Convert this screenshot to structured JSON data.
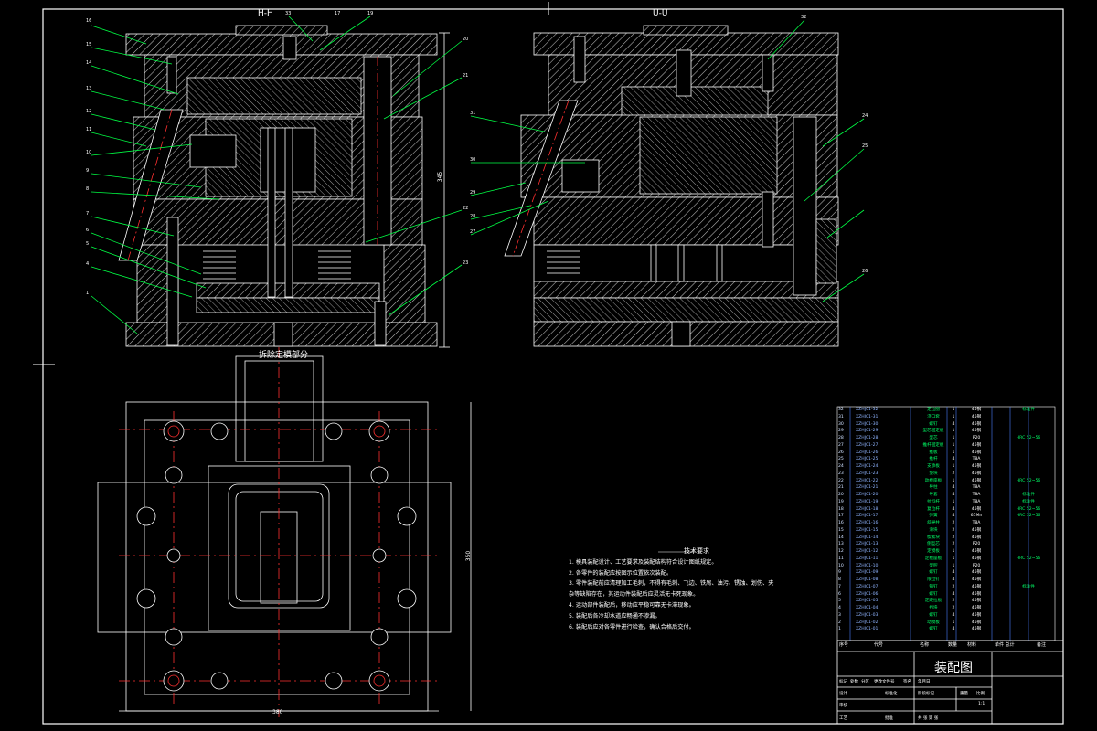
{
  "section_labels": {
    "left": "H-H",
    "right": "U-U"
  },
  "view_label": "拆除定模部分",
  "dimensions": {
    "overall_height": "345",
    "bottom_width": "380",
    "right_width": "350"
  },
  "left_callouts": [
    "16",
    "15",
    "14",
    "13",
    "12",
    "11",
    "10",
    "9",
    "8",
    "7",
    "6",
    "5",
    "4",
    "3",
    "2",
    "1"
  ],
  "top_callouts": [
    "33",
    "17",
    "18",
    "19"
  ],
  "right_callouts_left_view": [
    "20",
    "21",
    "22",
    "23"
  ],
  "right_view_callouts_left": [
    "31",
    "30",
    "29",
    "28",
    "27",
    "26"
  ],
  "right_view_callouts_right": [
    "32",
    "24",
    "25",
    "26"
  ],
  "technical_notes": {
    "title": "技术要求",
    "lines": [
      "1. 模具装配设计、工艺要求及装配结构符合设计图纸规定。",
      "2. 各零件的装配应按图示位置依次装配。",
      "3. 零件装配前应清理加工毛刺，不得有毛刺、飞边、铁屑、油污、锈蚀、划伤、夹",
      "   杂等缺陷存在，其运动件装配后应灵活无卡死现象。",
      "4. 运动部件装配后，移动应平稳可靠无卡滞现象。",
      "5. 装配后各冷却水道应畅通不渗漏。",
      "6. 装配后应对各零件进行检查，确认合格后交付。"
    ]
  },
  "bom": {
    "rows": [
      {
        "no": "32",
        "code": "XZHJ01-32",
        "name": "定位圈",
        "qty": "1",
        "material": "45钢",
        "note": "标准件"
      },
      {
        "no": "31",
        "code": "XZHJ01-31",
        "name": "浇口套",
        "qty": "1",
        "material": "45钢",
        "note": ""
      },
      {
        "no": "30",
        "code": "XZHJ01-30",
        "name": "螺钉",
        "qty": "4",
        "material": "45钢",
        "note": ""
      },
      {
        "no": "29",
        "code": "XZHJ01-29",
        "name": "型芯固定板",
        "qty": "1",
        "material": "45钢",
        "note": ""
      },
      {
        "no": "28",
        "code": "XZHJ01-28",
        "name": "型芯",
        "qty": "1",
        "material": "P20",
        "note": "HRC 52~56"
      },
      {
        "no": "27",
        "code": "XZHJ01-27",
        "name": "推杆固定板",
        "qty": "1",
        "material": "45钢",
        "note": ""
      },
      {
        "no": "26",
        "code": "XZHJ01-26",
        "name": "推板",
        "qty": "1",
        "material": "45钢",
        "note": ""
      },
      {
        "no": "25",
        "code": "XZHJ01-25",
        "name": "推杆",
        "qty": "4",
        "material": "T8A",
        "note": ""
      },
      {
        "no": "24",
        "code": "XZHJ01-24",
        "name": "支承板",
        "qty": "1",
        "material": "45钢",
        "note": ""
      },
      {
        "no": "23",
        "code": "XZHJ01-23",
        "name": "垫块",
        "qty": "2",
        "material": "45钢",
        "note": ""
      },
      {
        "no": "22",
        "code": "XZHJ01-22",
        "name": "动模座板",
        "qty": "1",
        "material": "45钢",
        "note": "HRC 52~56"
      },
      {
        "no": "21",
        "code": "XZHJ01-21",
        "name": "导柱",
        "qty": "4",
        "material": "T8A",
        "note": ""
      },
      {
        "no": "20",
        "code": "XZHJ01-20",
        "name": "导套",
        "qty": "4",
        "material": "T8A",
        "note": "标准件"
      },
      {
        "no": "19",
        "code": "XZHJ01-19",
        "name": "拉料杆",
        "qty": "1",
        "material": "T8A",
        "note": "标准件"
      },
      {
        "no": "18",
        "code": "XZHJ01-18",
        "name": "复位杆",
        "qty": "4",
        "material": "45钢",
        "note": "HRC 52~56"
      },
      {
        "no": "17",
        "code": "XZHJ01-17",
        "name": "弹簧",
        "qty": "4",
        "material": "65Mn",
        "note": "HRC 52~56"
      },
      {
        "no": "16",
        "code": "XZHJ01-16",
        "name": "斜导柱",
        "qty": "2",
        "material": "T8A",
        "note": ""
      },
      {
        "no": "15",
        "code": "XZHJ01-15",
        "name": "滑块",
        "qty": "2",
        "material": "45钢",
        "note": ""
      },
      {
        "no": "14",
        "code": "XZHJ01-14",
        "name": "楔紧块",
        "qty": "2",
        "material": "45钢",
        "note": ""
      },
      {
        "no": "13",
        "code": "XZHJ01-13",
        "name": "侧型芯",
        "qty": "2",
        "material": "P20",
        "note": ""
      },
      {
        "no": "12",
        "code": "XZHJ01-12",
        "name": "定模板",
        "qty": "1",
        "material": "45钢",
        "note": ""
      },
      {
        "no": "11",
        "code": "XZHJ01-11",
        "name": "定模座板",
        "qty": "1",
        "material": "45钢",
        "note": "HRC 52~56"
      },
      {
        "no": "10",
        "code": "XZHJ01-10",
        "name": "型腔",
        "qty": "1",
        "material": "P20",
        "note": ""
      },
      {
        "no": "9",
        "code": "XZHJ01-09",
        "name": "螺钉",
        "qty": "4",
        "material": "45钢",
        "note": ""
      },
      {
        "no": "8",
        "code": "XZHJ01-08",
        "name": "限位钉",
        "qty": "4",
        "material": "45钢",
        "note": ""
      },
      {
        "no": "7",
        "code": "XZHJ01-07",
        "name": "销钉",
        "qty": "2",
        "material": "45钢",
        "note": "标准件"
      },
      {
        "no": "6",
        "code": "XZHJ01-06",
        "name": "螺钉",
        "qty": "4",
        "material": "45钢",
        "note": ""
      },
      {
        "no": "5",
        "code": "XZHJ01-05",
        "name": "定距拉板",
        "qty": "2",
        "material": "45钢",
        "note": ""
      },
      {
        "no": "4",
        "code": "XZHJ01-04",
        "name": "挡块",
        "qty": "2",
        "material": "45钢",
        "note": ""
      },
      {
        "no": "3",
        "code": "XZHJ01-03",
        "name": "螺钉",
        "qty": "4",
        "material": "45钢",
        "note": ""
      },
      {
        "no": "2",
        "code": "XZHJ01-02",
        "name": "动模板",
        "qty": "1",
        "material": "45钢",
        "note": ""
      },
      {
        "no": "1",
        "code": "XZHJ01-01",
        "name": "螺钉",
        "qty": "4",
        "material": "45钢",
        "note": ""
      }
    ],
    "header": {
      "no": "序号",
      "code": "代号",
      "name": "名称",
      "qty": "数量",
      "material": "材料",
      "weight": "单件 总计",
      "note": "备注"
    }
  },
  "title_block": {
    "title": "装配图",
    "labels": [
      "标记",
      "处数",
      "分区",
      "更改文件号",
      "签名",
      "年月日"
    ],
    "rows": [
      "设计",
      "审核",
      "工艺"
    ],
    "stage": "阶段标记",
    "weight": "重量",
    "scale": "比例",
    "scale_value": "1:1",
    "sheet": "共 张 第 张",
    "std": "标准化",
    "approve": "批准"
  },
  "colors": {
    "line": "#ffffff",
    "hatch": "#c8c8c8",
    "leader": "#00ff44",
    "center": "#ff3030",
    "frame": "#ffffff",
    "table_blue": "#4a7dff"
  }
}
